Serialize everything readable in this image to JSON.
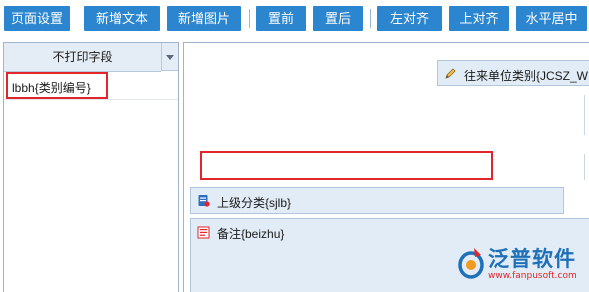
{
  "toolbar": {
    "buttons": [
      "页面设置",
      "新增文本",
      "新增图片",
      "置前",
      "置后",
      "左对齐",
      "上对齐",
      "水平居中"
    ]
  },
  "left_panel": {
    "header": "不打印字段",
    "rows": [
      "lbbh{类别编号}"
    ]
  },
  "canvas": {
    "fields": {
      "wllb": "往来单位类别{JCSZ_W",
      "sjlb": "上级分类{sjlb}",
      "beizhu": "备注{beizhu}"
    }
  },
  "watermark": {
    "name": "泛普软件",
    "url": "www.fanpusoft.com"
  },
  "colors": {
    "toolbar_button": "#2c86cf",
    "highlight_box": "#e0262b",
    "field_bg": "#e2ecf6",
    "header_bg": "#e4ecf5"
  },
  "icons": {
    "field_wllb": "pencil-icon",
    "field_sjlb": "document-icon",
    "field_beizhu": "text-lines-icon",
    "dropdown": "chevron-down-icon",
    "logo": "logo-ring-icon"
  }
}
